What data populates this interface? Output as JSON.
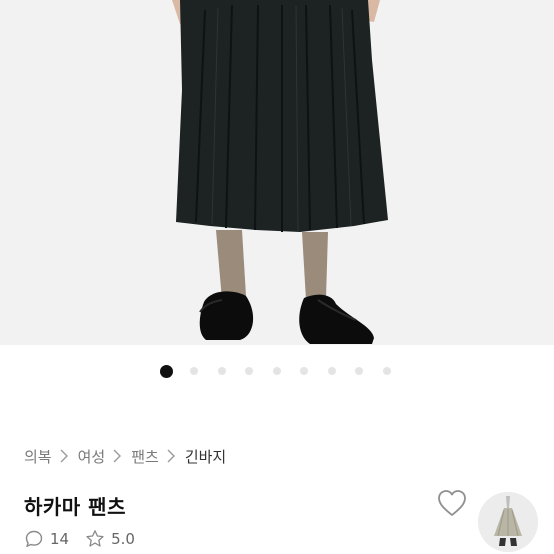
{
  "carousel": {
    "total": 9,
    "active": 0
  },
  "breadcrumb": [
    "의복",
    "여성",
    "팬츠",
    "긴바지"
  ],
  "product": {
    "title": "하카마 팬츠"
  },
  "stats": {
    "comments": "14",
    "rating": "5.0"
  },
  "icons": {
    "comment": "comment-icon",
    "rating": "star-icon",
    "like": "heart-icon"
  },
  "colors": {
    "active_dot": "#111111",
    "inactive_dot": "#e4e4e4"
  }
}
